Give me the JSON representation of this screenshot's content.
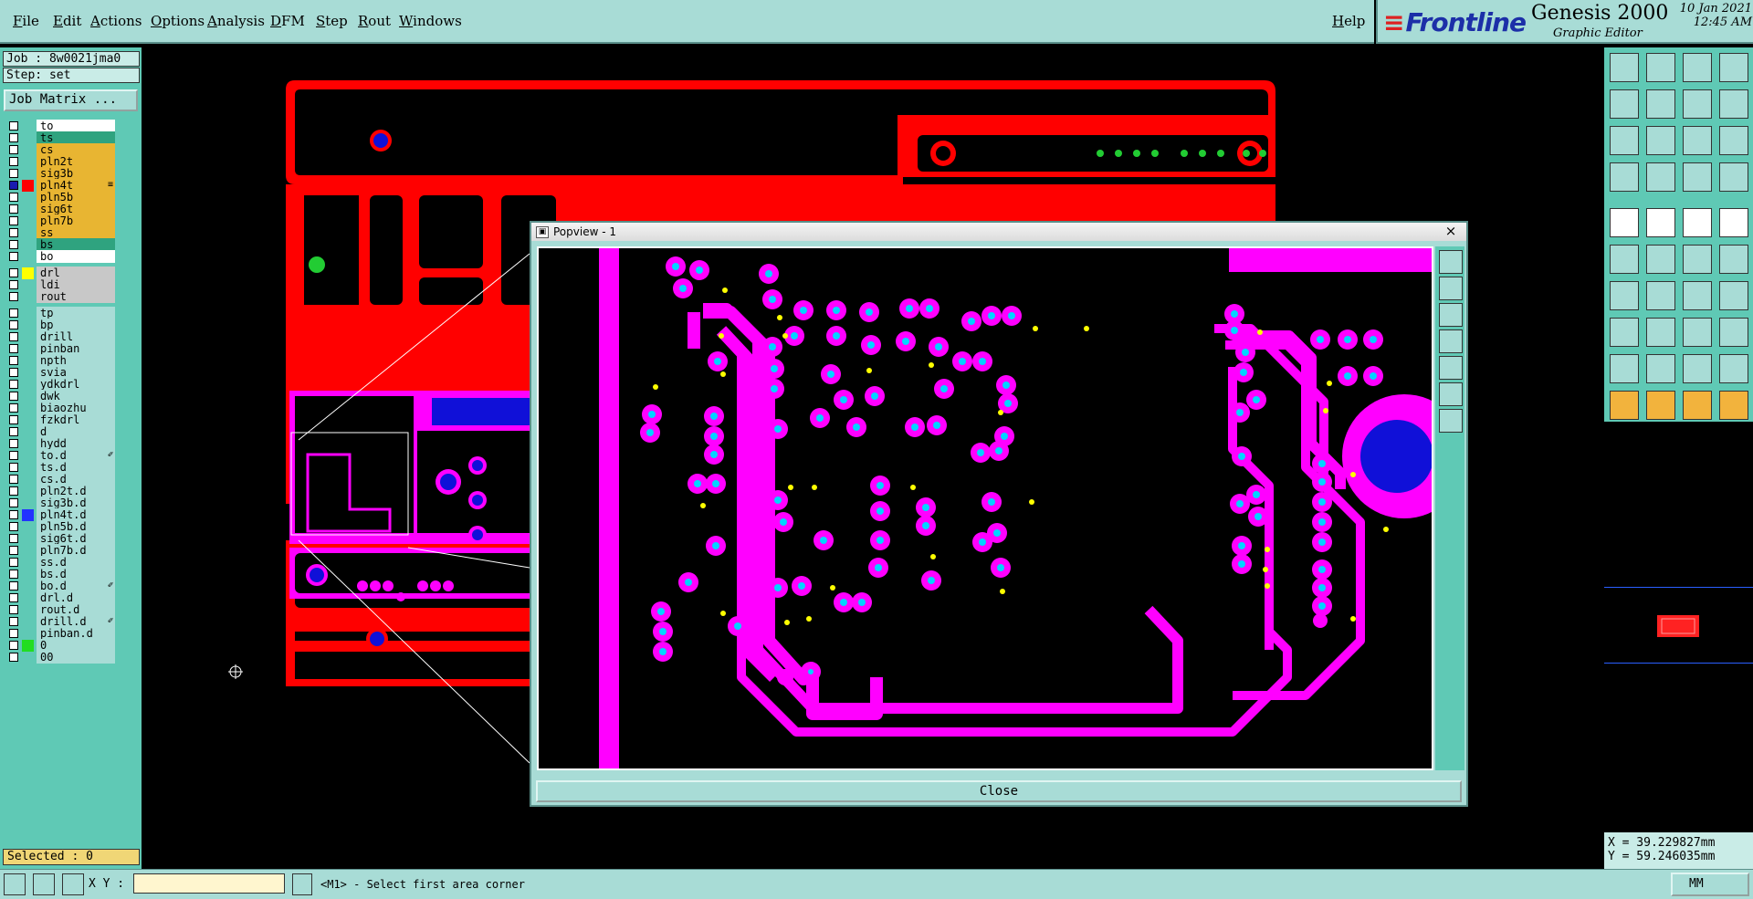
{
  "menu": {
    "items": [
      "File",
      "Edit",
      "Actions",
      "Options",
      "Analysis",
      "DFM",
      "Step",
      "Rout",
      "Windows"
    ],
    "help": "Help"
  },
  "brand": {
    "logo": "Frontline",
    "product": "Genesis 2000",
    "subtitle": "Graphic Editor",
    "date": "10 Jan 2021",
    "time": "12:45 AM"
  },
  "job": {
    "job_line": "Job : 8w0021jma0",
    "step_line": "Step: set",
    "matrix_button": "Job Matrix ..."
  },
  "layers": [
    {
      "name": "to",
      "bg": "#ffffff",
      "checked": false,
      "swatch": "",
      "mark": ""
    },
    {
      "name": "ts",
      "bg": "#2fa37f",
      "checked": false,
      "swatch": "",
      "mark": ""
    },
    {
      "name": "cs",
      "bg": "#e8b532",
      "checked": false,
      "swatch": "",
      "mark": ""
    },
    {
      "name": "pln2t",
      "bg": "#e8b532",
      "checked": false,
      "swatch": "",
      "mark": ""
    },
    {
      "name": "sig3b",
      "bg": "#e8b532",
      "checked": false,
      "swatch": "",
      "mark": ""
    },
    {
      "name": "pln4t",
      "bg": "#e8b532",
      "checked": true,
      "swatch": "#ff0000",
      "mark": "≡"
    },
    {
      "name": "pln5b",
      "bg": "#e8b532",
      "checked": false,
      "swatch": "",
      "mark": ""
    },
    {
      "name": "sig6t",
      "bg": "#e8b532",
      "checked": false,
      "swatch": "",
      "mark": ""
    },
    {
      "name": "pln7b",
      "bg": "#e8b532",
      "checked": false,
      "swatch": "",
      "mark": ""
    },
    {
      "name": "ss",
      "bg": "#e8b532",
      "checked": false,
      "swatch": "",
      "mark": ""
    },
    {
      "name": "bs",
      "bg": "#2fa37f",
      "checked": false,
      "swatch": "",
      "mark": ""
    },
    {
      "name": "bo",
      "bg": "#ffffff",
      "checked": false,
      "swatch": "",
      "mark": ""
    },
    {
      "name": "drl",
      "bg": "#c8c8c8",
      "checked": false,
      "swatch": "#ffff00",
      "mark": ""
    },
    {
      "name": "ldi",
      "bg": "#c8c8c8",
      "checked": false,
      "swatch": "",
      "mark": ""
    },
    {
      "name": "rout",
      "bg": "#c8c8c8",
      "checked": false,
      "swatch": "",
      "mark": ""
    },
    {
      "name": "tp",
      "bg": "#a8dcd6",
      "checked": false,
      "swatch": "",
      "mark": ""
    },
    {
      "name": "bp",
      "bg": "#a8dcd6",
      "checked": false,
      "swatch": "",
      "mark": ""
    },
    {
      "name": "drill",
      "bg": "#a8dcd6",
      "checked": false,
      "swatch": "",
      "mark": ""
    },
    {
      "name": "pinban",
      "bg": "#a8dcd6",
      "checked": false,
      "swatch": "",
      "mark": ""
    },
    {
      "name": "npth",
      "bg": "#a8dcd6",
      "checked": false,
      "swatch": "",
      "mark": ""
    },
    {
      "name": "svia",
      "bg": "#a8dcd6",
      "checked": false,
      "swatch": "",
      "mark": ""
    },
    {
      "name": "ydkdrl",
      "bg": "#a8dcd6",
      "checked": false,
      "swatch": "",
      "mark": ""
    },
    {
      "name": "dwk",
      "bg": "#a8dcd6",
      "checked": false,
      "swatch": "",
      "mark": ""
    },
    {
      "name": "biaozhu",
      "bg": "#a8dcd6",
      "checked": false,
      "swatch": "",
      "mark": ""
    },
    {
      "name": "fzkdrl",
      "bg": "#a8dcd6",
      "checked": false,
      "swatch": "",
      "mark": ""
    },
    {
      "name": "d",
      "bg": "#a8dcd6",
      "checked": false,
      "swatch": "",
      "mark": ""
    },
    {
      "name": "hydd",
      "bg": "#a8dcd6",
      "checked": false,
      "swatch": "",
      "mark": ""
    },
    {
      "name": "to.d",
      "bg": "#a8dcd6",
      "checked": false,
      "swatch": "",
      "mark": "✐"
    },
    {
      "name": "ts.d",
      "bg": "#a8dcd6",
      "checked": false,
      "swatch": "",
      "mark": ""
    },
    {
      "name": "cs.d",
      "bg": "#a8dcd6",
      "checked": false,
      "swatch": "",
      "mark": ""
    },
    {
      "name": "pln2t.d",
      "bg": "#a8dcd6",
      "checked": false,
      "swatch": "",
      "mark": ""
    },
    {
      "name": "sig3b.d",
      "bg": "#a8dcd6",
      "checked": false,
      "swatch": "",
      "mark": ""
    },
    {
      "name": "pln4t.d",
      "bg": "#a8dcd6",
      "checked": false,
      "swatch": "#2233ff",
      "mark": ""
    },
    {
      "name": "pln5b.d",
      "bg": "#a8dcd6",
      "checked": false,
      "swatch": "",
      "mark": ""
    },
    {
      "name": "sig6t.d",
      "bg": "#a8dcd6",
      "checked": false,
      "swatch": "",
      "mark": ""
    },
    {
      "name": "pln7b.d",
      "bg": "#a8dcd6",
      "checked": false,
      "swatch": "",
      "mark": ""
    },
    {
      "name": "ss.d",
      "bg": "#a8dcd6",
      "checked": false,
      "swatch": "",
      "mark": ""
    },
    {
      "name": "bs.d",
      "bg": "#a8dcd6",
      "checked": false,
      "swatch": "",
      "mark": ""
    },
    {
      "name": "bo.d",
      "bg": "#a8dcd6",
      "checked": false,
      "swatch": "",
      "mark": "✐"
    },
    {
      "name": "drl.d",
      "bg": "#a8dcd6",
      "checked": false,
      "swatch": "",
      "mark": ""
    },
    {
      "name": "rout.d",
      "bg": "#a8dcd6",
      "checked": false,
      "swatch": "",
      "mark": ""
    },
    {
      "name": "drill.d",
      "bg": "#a8dcd6",
      "checked": false,
      "swatch": "",
      "mark": "✐"
    },
    {
      "name": "pinban.d",
      "bg": "#a8dcd6",
      "checked": false,
      "swatch": "",
      "mark": ""
    },
    {
      "name": "0",
      "bg": "#a8dcd6",
      "checked": false,
      "swatch": "#22dd22",
      "mark": ""
    },
    {
      "name": "00",
      "bg": "#a8dcd6",
      "checked": false,
      "swatch": "",
      "mark": ""
    }
  ],
  "selected": "Selected : 0",
  "popview": {
    "title": "Popview - 1",
    "close_label": "Close",
    "close_x": "×"
  },
  "coords": {
    "x": "X = 39.229827mm",
    "y": "Y = 59.246035mm"
  },
  "status": {
    "xy_label": "X Y :",
    "xy_value": "",
    "prompt": "<M1> - Select first area corner",
    "units": "MM"
  },
  "colors": {
    "panel": "#5fc9b5",
    "chrome": "#a8dcd6",
    "layer_main": "#ff0000",
    "layer_popview": "#ff00ff",
    "via_center": "#00d4ff",
    "drill": "#ffff00",
    "plane_hole": "#1010d8"
  },
  "icons": {
    "right_toolbar": [
      "view-home-icon",
      "view-up-icon",
      "window-icon",
      "split-view-icon",
      "pan-left-icon",
      "pan-right-icon",
      "rotate-icon",
      "redo-icon",
      "zoom-fit-icon",
      "zoom-center-icon",
      "scale-1-2-icon",
      "help-icon",
      "measure-icon",
      "grid-icon",
      "snap-red-icon",
      "snap-blue-icon",
      "add-pad-icon",
      "add-line-icon",
      "ruler-icon",
      "circle-icon",
      "node-icon",
      "cross-icon",
      "arc-point-icon",
      "line-point-icon",
      "slash-red-icon",
      "slash-blue-icon",
      "arc-icon",
      "trace-icon",
      "select-pad-icon",
      "delete-line-icon",
      "box-icon",
      "group-icon",
      "angle-red-icon",
      "angle-blue-icon",
      "triangle-red-icon",
      "triangle-blue-icon",
      "pointer-icon",
      "pointer-red-icon",
      "pointer-yellow-icon",
      "pointer-multi-icon"
    ]
  }
}
